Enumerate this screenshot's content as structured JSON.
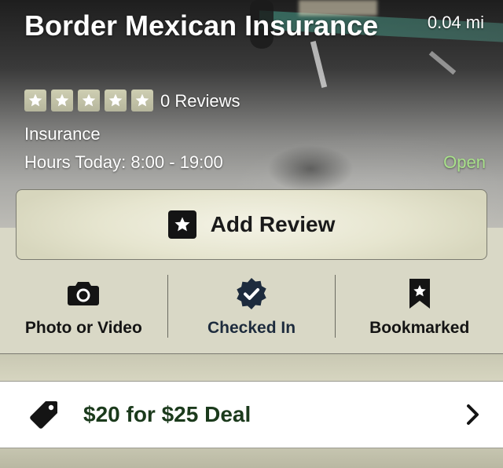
{
  "business": {
    "name": "Border Mexican Insurance",
    "distance": "0.04 mi",
    "rating_stars": 5,
    "rating_filled": 0,
    "reviews": "0 Reviews",
    "category": "Insurance",
    "hours": "Hours Today: 8:00 - 19:00",
    "status": "Open"
  },
  "add_review": {
    "label": "Add Review"
  },
  "actions": {
    "photo": {
      "label": "Photo or Video",
      "icon": "camera-icon"
    },
    "checkin": {
      "label": "Checked In",
      "icon": "checked-badge-icon"
    },
    "bookmark": {
      "label": "Bookmarked",
      "icon": "bookmark-icon"
    }
  },
  "deal": {
    "label": "$20 for $25 Deal",
    "icon": "tag-icon"
  },
  "colors": {
    "open_status": "#a8e08a",
    "deal_text": "#1b3a1c",
    "checked_text": "#1d2b3d"
  }
}
